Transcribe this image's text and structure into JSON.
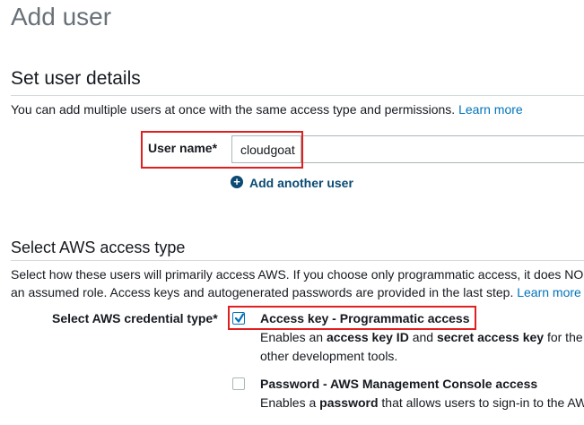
{
  "page": {
    "title": "Add user"
  },
  "user_details": {
    "section_title": "Set user details",
    "description": "You can add multiple users at once with the same access type and permissions.",
    "learn_more": "Learn more",
    "user_name_label": "User name*",
    "user_name_value": "cloudgoat",
    "add_another_label": "Add another user"
  },
  "access_type": {
    "section_title": "Select AWS access type",
    "description_line1": "Select how these users will primarily access AWS. If you choose only programmatic access, it does NO",
    "description_line2": "an assumed role. Access keys and autogenerated passwords are provided in the last step.",
    "learn_more": "Learn more",
    "credential_type_label": "Select AWS credential type*",
    "options": [
      {
        "title": "Access key - Programmatic access",
        "checked": true,
        "desc_part1": "Enables an ",
        "desc_bold1": "access key ID",
        "desc_part2": " and ",
        "desc_bold2": "secret access key",
        "desc_part3": " for the",
        "desc_line2": "other development tools."
      },
      {
        "title": "Password - AWS Management Console access",
        "checked": false,
        "desc_part1": "Enables a ",
        "desc_bold1": "password",
        "desc_part2": " that allows users to sign-in to the AW"
      }
    ]
  },
  "colors": {
    "link": "#0073bb",
    "highlight": "#e02020",
    "title_gray": "#687078",
    "divider": "#d5dbdb"
  }
}
